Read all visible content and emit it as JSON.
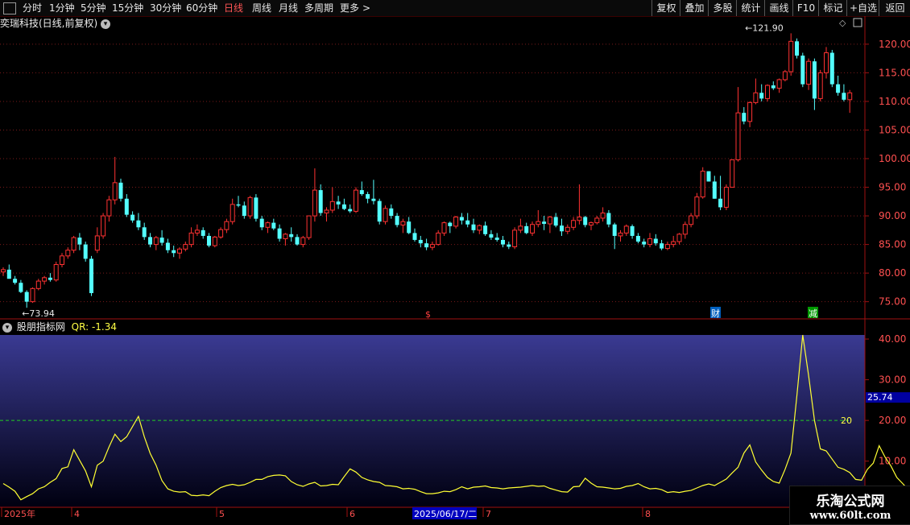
{
  "toolbar": {
    "periods": [
      "分时",
      "1分钟",
      "5分钟",
      "15分钟",
      "30分钟",
      "60分钟",
      "日线",
      "周线",
      "月线",
      "多周期",
      "更多"
    ],
    "active_period": "日线",
    "right_buttons": [
      "复权",
      "叠加",
      "多股",
      "统计",
      "画线",
      "F10",
      "标记",
      "+自选",
      "返回"
    ]
  },
  "stock_title": "奕瑞科技(日线,前复权)",
  "indicator": {
    "name": "股朋指标网",
    "value_label": "QR: -1.34",
    "reference_label": "20",
    "current_value_label": "25.74"
  },
  "markers": {
    "dollar": "$",
    "cai": "财",
    "jian": "减"
  },
  "watermark": {
    "line1": "乐淘公式网",
    "line2": "www.60lt.com"
  },
  "colors": {
    "up": "#ff3232",
    "down": "#54ffff",
    "line": "#ffff33",
    "ref": "#22cc22"
  },
  "chart_data": [
    {
      "type": "candlestick",
      "price_axis_ticks": [
        75,
        80,
        85,
        90,
        95,
        100,
        105,
        110,
        115,
        120
      ],
      "ylim": [
        72,
        123.5
      ],
      "annotations": [
        {
          "text": "73.94",
          "value": 73.94,
          "index": 4
        },
        {
          "text": "121.90",
          "value": 121.9,
          "index": 127
        }
      ],
      "candles": [
        [
          80.2,
          81.0,
          79.5,
          80.6
        ],
        [
          80.6,
          81.5,
          79.5,
          79.0
        ],
        [
          79.0,
          79.5,
          78.0,
          78.3
        ],
        [
          78.3,
          78.8,
          76.5,
          76.7
        ],
        [
          76.7,
          77.0,
          73.94,
          75.0
        ],
        [
          75.0,
          77.5,
          74.8,
          77.3
        ],
        [
          77.3,
          79.0,
          77.0,
          78.6
        ],
        [
          78.6,
          79.5,
          78.0,
          79.2
        ],
        [
          79.2,
          80.0,
          78.5,
          78.8
        ],
        [
          78.8,
          82.0,
          78.5,
          81.5
        ],
        [
          81.5,
          83.5,
          81.0,
          83.0
        ],
        [
          83.0,
          84.5,
          82.5,
          84.0
        ],
        [
          84.0,
          86.5,
          83.5,
          86.2
        ],
        [
          86.2,
          87.0,
          84.0,
          85.0
        ],
        [
          85.0,
          85.5,
          82.0,
          82.5
        ],
        [
          82.5,
          83.0,
          76.0,
          76.5
        ],
        [
          84.0,
          88.0,
          83.5,
          86.5
        ],
        [
          86.5,
          90.5,
          86.0,
          90.0
        ],
        [
          90.0,
          93.5,
          89.0,
          92.8
        ],
        [
          92.8,
          100.3,
          92.0,
          95.8
        ],
        [
          95.8,
          96.5,
          92.5,
          93.0
        ],
        [
          93.0,
          93.8,
          89.8,
          90.2
        ],
        [
          90.2,
          90.8,
          88.8,
          89.2
        ],
        [
          89.2,
          90.5,
          87.5,
          88.0
        ],
        [
          88.0,
          88.8,
          85.8,
          86.3
        ],
        [
          86.3,
          87.0,
          84.5,
          85.0
        ],
        [
          85.0,
          86.5,
          84.0,
          86.2
        ],
        [
          86.2,
          87.5,
          84.8,
          85.3
        ],
        [
          85.3,
          86.0,
          83.5,
          84.0
        ],
        [
          84.0,
          84.8,
          82.8,
          83.5
        ],
        [
          83.5,
          84.5,
          82.5,
          84.2
        ],
        [
          84.2,
          85.5,
          83.8,
          85.0
        ],
        [
          85.0,
          88.0,
          84.5,
          87.0
        ],
        [
          87.0,
          88.5,
          86.5,
          87.5
        ],
        [
          87.5,
          88.0,
          86.0,
          86.5
        ],
        [
          86.5,
          87.0,
          84.5,
          84.8
        ],
        [
          84.8,
          86.5,
          84.5,
          86.3
        ],
        [
          86.3,
          88.0,
          86.0,
          87.6
        ],
        [
          87.6,
          89.5,
          87.0,
          89.0
        ],
        [
          89.0,
          93.0,
          88.5,
          92.0
        ],
        [
          92.0,
          93.5,
          91.5,
          91.8
        ],
        [
          91.8,
          92.5,
          89.5,
          90.0
        ],
        [
          90.0,
          93.5,
          89.5,
          93.2
        ],
        [
          93.2,
          93.8,
          89.0,
          89.5
        ],
        [
          89.5,
          90.0,
          87.5,
          88.0
        ],
        [
          88.0,
          89.0,
          87.0,
          88.8
        ],
        [
          88.8,
          89.5,
          87.5,
          87.8
        ],
        [
          87.8,
          88.5,
          85.5,
          86.0
        ],
        [
          86.0,
          87.0,
          84.8,
          86.8
        ],
        [
          86.8,
          88.0,
          85.5,
          86.3
        ],
        [
          86.3,
          86.8,
          84.8,
          85.0
        ],
        [
          85.0,
          86.5,
          84.5,
          86.2
        ],
        [
          86.2,
          90.0,
          85.8,
          90.0
        ],
        [
          90.0,
          98.3,
          89.0,
          94.5
        ],
        [
          94.5,
          95.5,
          90.0,
          90.5
        ],
        [
          90.5,
          91.5,
          89.0,
          91.0
        ],
        [
          91.0,
          95.0,
          90.5,
          92.5
        ],
        [
          92.5,
          93.5,
          91.2,
          92.0
        ],
        [
          92.0,
          93.0,
          91.0,
          91.2
        ],
        [
          91.2,
          92.0,
          90.5,
          90.8
        ],
        [
          90.8,
          95.0,
          90.5,
          94.5
        ],
        [
          94.5,
          96.0,
          93.5,
          93.8
        ],
        [
          93.8,
          94.2,
          92.2,
          93.0
        ],
        [
          93.0,
          96.3,
          92.0,
          92.6
        ],
        [
          92.6,
          93.0,
          88.5,
          89.0
        ],
        [
          89.0,
          91.8,
          88.5,
          91.3
        ],
        [
          91.3,
          92.0,
          89.5,
          90.0
        ],
        [
          90.0,
          90.5,
          88.0,
          88.4
        ],
        [
          88.4,
          89.5,
          87.0,
          89.0
        ],
        [
          89.0,
          89.8,
          86.8,
          87.0
        ],
        [
          87.0,
          87.8,
          85.5,
          85.8
        ],
        [
          85.8,
          86.5,
          84.5,
          85.2
        ],
        [
          85.2,
          86.0,
          84.0,
          84.5
        ],
        [
          84.5,
          85.5,
          84.0,
          85.0
        ],
        [
          85.0,
          87.5,
          84.8,
          87.0
        ],
        [
          87.0,
          89.0,
          86.5,
          88.8
        ],
        [
          88.8,
          89.0,
          87.0,
          88.2
        ],
        [
          88.2,
          90.0,
          87.8,
          89.8
        ],
        [
          89.8,
          90.5,
          88.5,
          89.2
        ],
        [
          89.2,
          90.5,
          88.0,
          88.5
        ],
        [
          88.5,
          89.5,
          87.0,
          87.5
        ],
        [
          87.5,
          88.5,
          86.8,
          88.3
        ],
        [
          88.3,
          89.0,
          86.5,
          86.8
        ],
        [
          86.8,
          87.5,
          85.8,
          86.2
        ],
        [
          86.2,
          87.0,
          85.5,
          85.8
        ],
        [
          85.8,
          86.5,
          84.5,
          85.0
        ],
        [
          85.0,
          85.5,
          84.2,
          84.6
        ],
        [
          84.6,
          88.0,
          84.2,
          87.5
        ],
        [
          87.5,
          89.5,
          87.0,
          88.2
        ],
        [
          88.2,
          88.8,
          86.8,
          87.0
        ],
        [
          87.0,
          89.0,
          86.5,
          88.5
        ],
        [
          88.5,
          91.0,
          88.0,
          89.0
        ],
        [
          89.0,
          90.0,
          87.5,
          88.6
        ],
        [
          88.6,
          90.0,
          87.0,
          89.8
        ],
        [
          89.8,
          90.5,
          88.0,
          88.3
        ],
        [
          88.3,
          89.5,
          86.5,
          87.3
        ],
        [
          87.3,
          88.5,
          86.8,
          88.0
        ],
        [
          88.0,
          89.8,
          87.5,
          89.2
        ],
        [
          89.2,
          95.5,
          88.5,
          89.8
        ],
        [
          89.8,
          90.0,
          88.0,
          88.4
        ],
        [
          88.4,
          89.0,
          87.5,
          88.8
        ],
        [
          88.8,
          90.0,
          88.5,
          89.6
        ],
        [
          89.6,
          91.5,
          89.0,
          90.5
        ],
        [
          90.5,
          91.0,
          88.0,
          88.5
        ],
        [
          88.5,
          88.8,
          84.2,
          86.5
        ],
        [
          86.5,
          87.5,
          85.5,
          87.0
        ],
        [
          87.0,
          88.5,
          86.5,
          88.2
        ],
        [
          88.2,
          88.5,
          86.0,
          86.5
        ],
        [
          86.5,
          87.0,
          85.2,
          85.5
        ],
        [
          85.5,
          86.0,
          84.5,
          85.0
        ],
        [
          85.0,
          87.0,
          84.5,
          86.0
        ],
        [
          86.0,
          86.8,
          84.8,
          85.2
        ],
        [
          85.2,
          85.8,
          84.0,
          84.3
        ],
        [
          84.3,
          85.5,
          84.0,
          85.0
        ],
        [
          85.0,
          86.5,
          84.5,
          85.5
        ],
        [
          85.5,
          87.0,
          85.0,
          86.8
        ],
        [
          86.8,
          89.0,
          86.0,
          88.5
        ],
        [
          88.5,
          90.5,
          88.0,
          90.0
        ],
        [
          90.0,
          94.0,
          89.5,
          93.3
        ],
        [
          93.3,
          98.5,
          93.0,
          97.8
        ],
        [
          97.8,
          97.8,
          96.0,
          96.0
        ],
        [
          96.0,
          97.0,
          93.0,
          93.0
        ],
        [
          93.0,
          97.0,
          91.0,
          91.5
        ],
        [
          91.5,
          95.5,
          91.0,
          95.0
        ],
        [
          95.0,
          95.3,
          99.8,
          99.8
        ],
        [
          99.8,
          112.5,
          99.5,
          108.0
        ],
        [
          108.0,
          109.0,
          106.0,
          106.5
        ],
        [
          106.5,
          110.0,
          105.5,
          109.8
        ],
        [
          109.8,
          114.0,
          109.5,
          111.5
        ],
        [
          111.5,
          113.0,
          110.0,
          110.5
        ],
        [
          110.5,
          113.0,
          110.0,
          112.8
        ],
        [
          112.8,
          113.5,
          112.0,
          112.3
        ],
        [
          112.3,
          114.0,
          111.5,
          113.8
        ],
        [
          113.8,
          115.5,
          113.5,
          115.2
        ],
        [
          115.2,
          121.9,
          114.5,
          120.5
        ],
        [
          120.5,
          121.0,
          117.5,
          118.0
        ],
        [
          118.0,
          118.5,
          112.5,
          113.0
        ],
        [
          113.0,
          117.5,
          112.0,
          117.0
        ],
        [
          117.0,
          117.5,
          108.5,
          110.5
        ],
        [
          110.5,
          115.5,
          110.0,
          115.0
        ],
        [
          115.0,
          119.5,
          114.0,
          118.5
        ],
        [
          118.5,
          119.0,
          112.5,
          113.0
        ],
        [
          113.0,
          114.5,
          111.0,
          111.5
        ],
        [
          111.5,
          113.0,
          110.0,
          110.3
        ],
        [
          110.3,
          112.0,
          108.0,
          111.5
        ]
      ]
    },
    {
      "type": "line",
      "name": "QR",
      "yticks": [
        "10.00",
        "20.00",
        "30.00",
        "40.00"
      ],
      "ylim": [
        -1.34,
        41
      ],
      "reference_line": 20,
      "x_labels": [
        "2025年",
        "4",
        "5",
        "6",
        "7",
        "8"
      ],
      "highlighted_date": "2025/06/17/二",
      "values": [
        4.5,
        3.6,
        2.6,
        0.5,
        1.3,
        2.0,
        3.2,
        3.7,
        4.8,
        5.7,
        8.2,
        8.6,
        12.8,
        10.2,
        7.6,
        3.7,
        9.0,
        10.0,
        13.5,
        16.6,
        14.8,
        16.0,
        18.5,
        21.0,
        16.0,
        11.9,
        9.0,
        5.2,
        3.2,
        2.6,
        2.4,
        2.5,
        1.6,
        1.5,
        1.7,
        1.5,
        2.6,
        3.5,
        4.0,
        4.3,
        4.0,
        4.2,
        4.8,
        5.5,
        5.5,
        6.2,
        6.5,
        6.6,
        6.4,
        5.0,
        4.2,
        3.8,
        4.4,
        4.8,
        3.9,
        4.0,
        4.3,
        4.2,
        6.2,
        8.1,
        7.3,
        6.0,
        5.4,
        5.0,
        4.8,
        4.0,
        3.9,
        3.7,
        3.2,
        3.3,
        3.1,
        2.5,
        2.0,
        2.0,
        2.2,
        2.6,
        2.5,
        3.0,
        3.7,
        3.2,
        3.6,
        3.7,
        3.9,
        3.5,
        3.4,
        3.2,
        3.4,
        3.5,
        3.6,
        3.8,
        4.0,
        3.8,
        3.9,
        3.3,
        2.9,
        2.5,
        2.4,
        3.7,
        3.8,
        5.8,
        4.6,
        3.7,
        3.6,
        3.4,
        3.2,
        3.3,
        3.8,
        4.0,
        4.5,
        3.7,
        3.2,
        3.3,
        3.0,
        2.3,
        2.5,
        2.3,
        2.6,
        2.8,
        3.4,
        4.0,
        4.4,
        4.0,
        4.8,
        5.6,
        7.1,
        8.5,
        12.0,
        14.0,
        9.8,
        7.8,
        6.0,
        5.0,
        4.6,
        8.0,
        12.0,
        26.0,
        41.0,
        31.0,
        20.0,
        13.0,
        12.5,
        10.5,
        8.5,
        8.0,
        7.2,
        5.5,
        5.3,
        8.0,
        9.5,
        13.8,
        11.0,
        8.8,
        6.0,
        4.5,
        2.9,
        2.5,
        4.0,
        4.5,
        3.8,
        4.0,
        -1.34
      ]
    }
  ]
}
